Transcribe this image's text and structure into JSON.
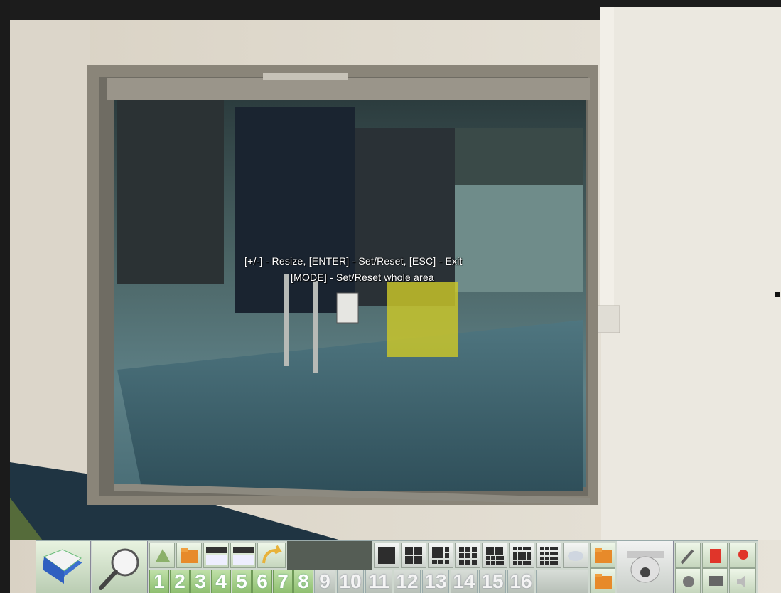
{
  "osd": {
    "line1": "[+/-] - Resize, [ENTER] - Set/Reset, [ESC] - Exit",
    "line2": "[MODE] - Set/Reset whole area"
  },
  "motion_area": {
    "color": "#cdc828"
  },
  "toolbar": {
    "channels": [
      "1",
      "2",
      "3",
      "4",
      "5",
      "6",
      "7",
      "8",
      "9",
      "10",
      "11",
      "12",
      "13",
      "14",
      "15",
      "16"
    ],
    "icons": [
      "menu-book-icon",
      "search-magnifier-icon",
      "playback-icon",
      "folder-icon",
      "screen-icon",
      "screen-icon",
      "return-arrow-icon",
      "ptz-camera-icon",
      "record-icon"
    ]
  }
}
